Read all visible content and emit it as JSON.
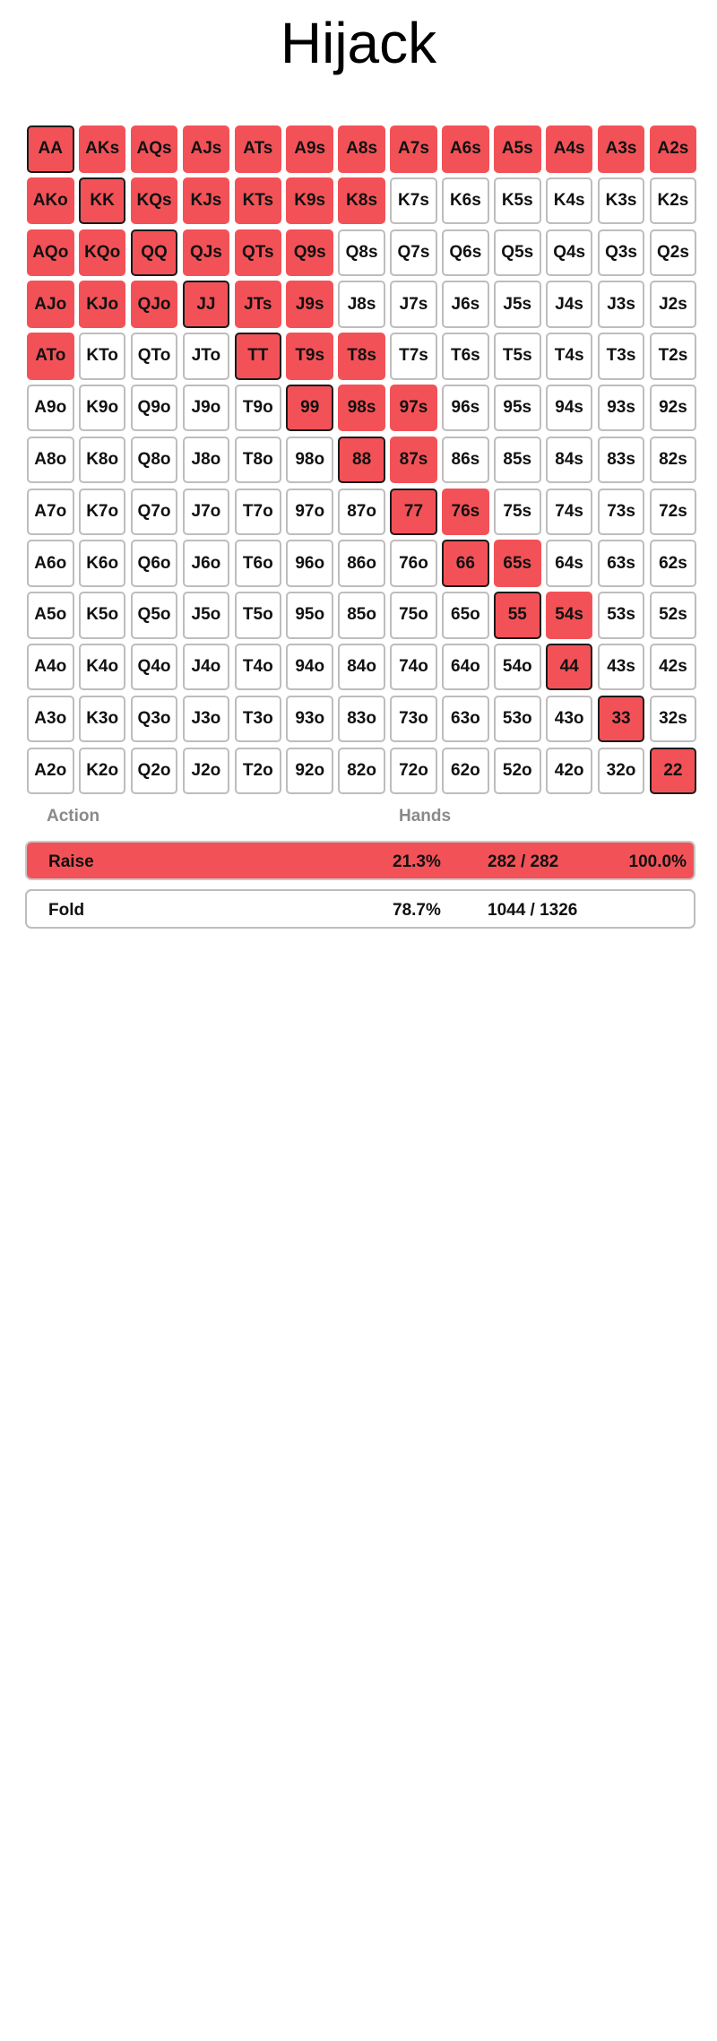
{
  "title": "Hijack",
  "colors": {
    "raise": "#f25257",
    "fold": "#ffffff",
    "pair_border": "#1a1a1a",
    "cell_border": "#bdbdbd"
  },
  "grid": {
    "rows": [
      [
        {
          "h": "AA",
          "a": "raise"
        },
        {
          "h": "AKs",
          "a": "raise"
        },
        {
          "h": "AQs",
          "a": "raise"
        },
        {
          "h": "AJs",
          "a": "raise"
        },
        {
          "h": "ATs",
          "a": "raise"
        },
        {
          "h": "A9s",
          "a": "raise"
        },
        {
          "h": "A8s",
          "a": "raise"
        },
        {
          "h": "A7s",
          "a": "raise"
        },
        {
          "h": "A6s",
          "a": "raise"
        },
        {
          "h": "A5s",
          "a": "raise"
        },
        {
          "h": "A4s",
          "a": "raise"
        },
        {
          "h": "A3s",
          "a": "raise"
        },
        {
          "h": "A2s",
          "a": "raise"
        }
      ],
      [
        {
          "h": "AKo",
          "a": "raise"
        },
        {
          "h": "KK",
          "a": "raise"
        },
        {
          "h": "KQs",
          "a": "raise"
        },
        {
          "h": "KJs",
          "a": "raise"
        },
        {
          "h": "KTs",
          "a": "raise"
        },
        {
          "h": "K9s",
          "a": "raise"
        },
        {
          "h": "K8s",
          "a": "raise"
        },
        {
          "h": "K7s",
          "a": "fold"
        },
        {
          "h": "K6s",
          "a": "fold"
        },
        {
          "h": "K5s",
          "a": "fold"
        },
        {
          "h": "K4s",
          "a": "fold"
        },
        {
          "h": "K3s",
          "a": "fold"
        },
        {
          "h": "K2s",
          "a": "fold"
        }
      ],
      [
        {
          "h": "AQo",
          "a": "raise"
        },
        {
          "h": "KQo",
          "a": "raise"
        },
        {
          "h": "QQ",
          "a": "raise"
        },
        {
          "h": "QJs",
          "a": "raise"
        },
        {
          "h": "QTs",
          "a": "raise"
        },
        {
          "h": "Q9s",
          "a": "raise"
        },
        {
          "h": "Q8s",
          "a": "fold"
        },
        {
          "h": "Q7s",
          "a": "fold"
        },
        {
          "h": "Q6s",
          "a": "fold"
        },
        {
          "h": "Q5s",
          "a": "fold"
        },
        {
          "h": "Q4s",
          "a": "fold"
        },
        {
          "h": "Q3s",
          "a": "fold"
        },
        {
          "h": "Q2s",
          "a": "fold"
        }
      ],
      [
        {
          "h": "AJo",
          "a": "raise"
        },
        {
          "h": "KJo",
          "a": "raise"
        },
        {
          "h": "QJo",
          "a": "raise"
        },
        {
          "h": "JJ",
          "a": "raise"
        },
        {
          "h": "JTs",
          "a": "raise"
        },
        {
          "h": "J9s",
          "a": "raise"
        },
        {
          "h": "J8s",
          "a": "fold"
        },
        {
          "h": "J7s",
          "a": "fold"
        },
        {
          "h": "J6s",
          "a": "fold"
        },
        {
          "h": "J5s",
          "a": "fold"
        },
        {
          "h": "J4s",
          "a": "fold"
        },
        {
          "h": "J3s",
          "a": "fold"
        },
        {
          "h": "J2s",
          "a": "fold"
        }
      ],
      [
        {
          "h": "ATo",
          "a": "raise"
        },
        {
          "h": "KTo",
          "a": "fold"
        },
        {
          "h": "QTo",
          "a": "fold"
        },
        {
          "h": "JTo",
          "a": "fold"
        },
        {
          "h": "TT",
          "a": "raise"
        },
        {
          "h": "T9s",
          "a": "raise"
        },
        {
          "h": "T8s",
          "a": "raise"
        },
        {
          "h": "T7s",
          "a": "fold"
        },
        {
          "h": "T6s",
          "a": "fold"
        },
        {
          "h": "T5s",
          "a": "fold"
        },
        {
          "h": "T4s",
          "a": "fold"
        },
        {
          "h": "T3s",
          "a": "fold"
        },
        {
          "h": "T2s",
          "a": "fold"
        }
      ],
      [
        {
          "h": "A9o",
          "a": "fold"
        },
        {
          "h": "K9o",
          "a": "fold"
        },
        {
          "h": "Q9o",
          "a": "fold"
        },
        {
          "h": "J9o",
          "a": "fold"
        },
        {
          "h": "T9o",
          "a": "fold"
        },
        {
          "h": "99",
          "a": "raise"
        },
        {
          "h": "98s",
          "a": "raise"
        },
        {
          "h": "97s",
          "a": "raise"
        },
        {
          "h": "96s",
          "a": "fold"
        },
        {
          "h": "95s",
          "a": "fold"
        },
        {
          "h": "94s",
          "a": "fold"
        },
        {
          "h": "93s",
          "a": "fold"
        },
        {
          "h": "92s",
          "a": "fold"
        }
      ],
      [
        {
          "h": "A8o",
          "a": "fold"
        },
        {
          "h": "K8o",
          "a": "fold"
        },
        {
          "h": "Q8o",
          "a": "fold"
        },
        {
          "h": "J8o",
          "a": "fold"
        },
        {
          "h": "T8o",
          "a": "fold"
        },
        {
          "h": "98o",
          "a": "fold"
        },
        {
          "h": "88",
          "a": "raise"
        },
        {
          "h": "87s",
          "a": "raise"
        },
        {
          "h": "86s",
          "a": "fold"
        },
        {
          "h": "85s",
          "a": "fold"
        },
        {
          "h": "84s",
          "a": "fold"
        },
        {
          "h": "83s",
          "a": "fold"
        },
        {
          "h": "82s",
          "a": "fold"
        }
      ],
      [
        {
          "h": "A7o",
          "a": "fold"
        },
        {
          "h": "K7o",
          "a": "fold"
        },
        {
          "h": "Q7o",
          "a": "fold"
        },
        {
          "h": "J7o",
          "a": "fold"
        },
        {
          "h": "T7o",
          "a": "fold"
        },
        {
          "h": "97o",
          "a": "fold"
        },
        {
          "h": "87o",
          "a": "fold"
        },
        {
          "h": "77",
          "a": "raise"
        },
        {
          "h": "76s",
          "a": "raise"
        },
        {
          "h": "75s",
          "a": "fold"
        },
        {
          "h": "74s",
          "a": "fold"
        },
        {
          "h": "73s",
          "a": "fold"
        },
        {
          "h": "72s",
          "a": "fold"
        }
      ],
      [
        {
          "h": "A6o",
          "a": "fold"
        },
        {
          "h": "K6o",
          "a": "fold"
        },
        {
          "h": "Q6o",
          "a": "fold"
        },
        {
          "h": "J6o",
          "a": "fold"
        },
        {
          "h": "T6o",
          "a": "fold"
        },
        {
          "h": "96o",
          "a": "fold"
        },
        {
          "h": "86o",
          "a": "fold"
        },
        {
          "h": "76o",
          "a": "fold"
        },
        {
          "h": "66",
          "a": "raise"
        },
        {
          "h": "65s",
          "a": "raise"
        },
        {
          "h": "64s",
          "a": "fold"
        },
        {
          "h": "63s",
          "a": "fold"
        },
        {
          "h": "62s",
          "a": "fold"
        }
      ],
      [
        {
          "h": "A5o",
          "a": "fold"
        },
        {
          "h": "K5o",
          "a": "fold"
        },
        {
          "h": "Q5o",
          "a": "fold"
        },
        {
          "h": "J5o",
          "a": "fold"
        },
        {
          "h": "T5o",
          "a": "fold"
        },
        {
          "h": "95o",
          "a": "fold"
        },
        {
          "h": "85o",
          "a": "fold"
        },
        {
          "h": "75o",
          "a": "fold"
        },
        {
          "h": "65o",
          "a": "fold"
        },
        {
          "h": "55",
          "a": "raise"
        },
        {
          "h": "54s",
          "a": "raise"
        },
        {
          "h": "53s",
          "a": "fold"
        },
        {
          "h": "52s",
          "a": "fold"
        }
      ],
      [
        {
          "h": "A4o",
          "a": "fold"
        },
        {
          "h": "K4o",
          "a": "fold"
        },
        {
          "h": "Q4o",
          "a": "fold"
        },
        {
          "h": "J4o",
          "a": "fold"
        },
        {
          "h": "T4o",
          "a": "fold"
        },
        {
          "h": "94o",
          "a": "fold"
        },
        {
          "h": "84o",
          "a": "fold"
        },
        {
          "h": "74o",
          "a": "fold"
        },
        {
          "h": "64o",
          "a": "fold"
        },
        {
          "h": "54o",
          "a": "fold"
        },
        {
          "h": "44",
          "a": "raise"
        },
        {
          "h": "43s",
          "a": "fold"
        },
        {
          "h": "42s",
          "a": "fold"
        }
      ],
      [
        {
          "h": "A3o",
          "a": "fold"
        },
        {
          "h": "K3o",
          "a": "fold"
        },
        {
          "h": "Q3o",
          "a": "fold"
        },
        {
          "h": "J3o",
          "a": "fold"
        },
        {
          "h": "T3o",
          "a": "fold"
        },
        {
          "h": "93o",
          "a": "fold"
        },
        {
          "h": "83o",
          "a": "fold"
        },
        {
          "h": "73o",
          "a": "fold"
        },
        {
          "h": "63o",
          "a": "fold"
        },
        {
          "h": "53o",
          "a": "fold"
        },
        {
          "h": "43o",
          "a": "fold"
        },
        {
          "h": "33",
          "a": "raise"
        },
        {
          "h": "32s",
          "a": "fold"
        }
      ],
      [
        {
          "h": "A2o",
          "a": "fold"
        },
        {
          "h": "K2o",
          "a": "fold"
        },
        {
          "h": "Q2o",
          "a": "fold"
        },
        {
          "h": "J2o",
          "a": "fold"
        },
        {
          "h": "T2o",
          "a": "fold"
        },
        {
          "h": "92o",
          "a": "fold"
        },
        {
          "h": "82o",
          "a": "fold"
        },
        {
          "h": "72o",
          "a": "fold"
        },
        {
          "h": "62o",
          "a": "fold"
        },
        {
          "h": "52o",
          "a": "fold"
        },
        {
          "h": "42o",
          "a": "fold"
        },
        {
          "h": "32o",
          "a": "fold"
        },
        {
          "h": "22",
          "a": "raise"
        }
      ]
    ]
  },
  "summary": {
    "header_action": "Action",
    "header_hands": "Hands",
    "raise": {
      "name": "Raise",
      "pct": "21.3%",
      "combos": "282 / 282",
      "freq": "100.0%"
    },
    "fold": {
      "name": "Fold",
      "pct": "78.7%",
      "combos": "1044 / 1326"
    }
  }
}
